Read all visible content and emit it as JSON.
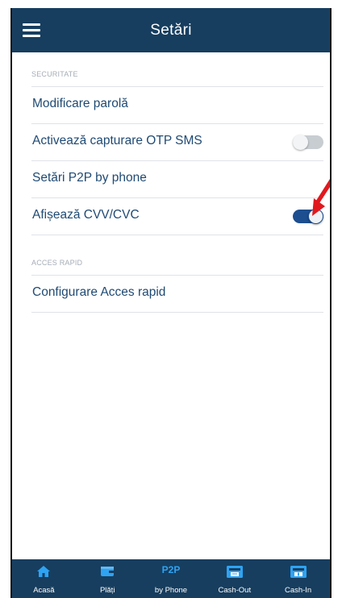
{
  "header": {
    "title": "Setări",
    "menu_icon": "hamburger-menu-icon"
  },
  "sections": [
    {
      "label": "SECURITATE",
      "items": [
        {
          "label": "Modificare parolă"
        },
        {
          "label": "Activează capturare OTP SMS",
          "toggle": "off"
        },
        {
          "label": "Setări P2P by phone"
        },
        {
          "label": "Afișează CVV/CVC",
          "toggle": "on"
        }
      ]
    },
    {
      "label": "ACCES RAPID",
      "items": [
        {
          "label": "Configurare Acces rapid"
        }
      ]
    }
  ],
  "annotation": {
    "icon": "red-arrow-icon",
    "color": "#e0191e"
  },
  "tabbar": {
    "items": [
      {
        "label": "Acasă",
        "icon": "home-icon"
      },
      {
        "label": "Plăți",
        "icon": "wallet-icon"
      },
      {
        "label": "by Phone",
        "icon_text": "P2P"
      },
      {
        "label": "Cash-Out",
        "icon": "atm-cash-out-icon"
      },
      {
        "label": "Cash-In",
        "icon": "atm-cash-in-icon"
      }
    ]
  },
  "colors": {
    "header_bg": "#173e5f",
    "accent": "#2ea3f2",
    "item_text": "#1f4a73",
    "toggle_on": "#1d4e8f"
  }
}
